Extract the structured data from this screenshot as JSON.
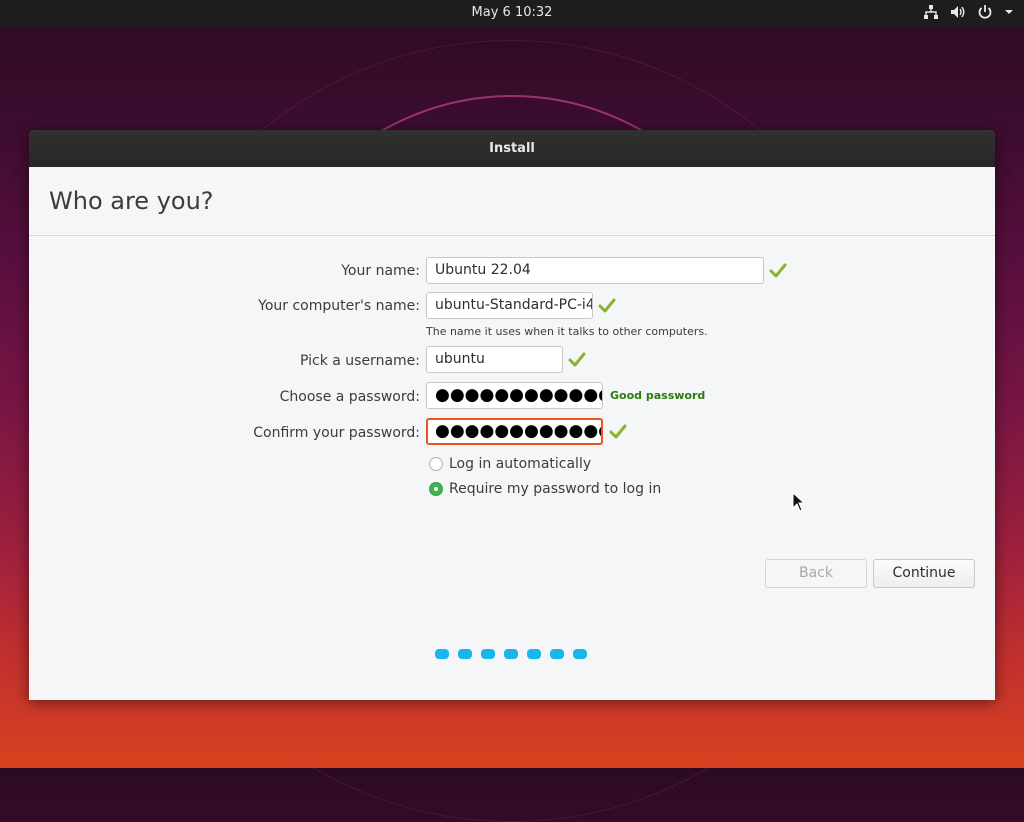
{
  "topbar": {
    "clock": "May 6  10:32",
    "icons": [
      "network-icon",
      "volume-icon",
      "power-icon",
      "menu-arrow-icon"
    ]
  },
  "window": {
    "title": "Install",
    "page_title": "Who are you?"
  },
  "form": {
    "name_label": "Your name:",
    "name_value": "Ubuntu 22.04",
    "computer_label": "Your computer's name:",
    "computer_value": "ubuntu-Standard-PC-i4",
    "computer_hint": "The name it uses when it talks to other computers.",
    "username_label": "Pick a username:",
    "username_value": "ubuntu",
    "password_label": "Choose a password:",
    "password_value": "●●●●●●●●●●●●",
    "password_strength": "Good password",
    "confirm_label": "Confirm your password:",
    "confirm_value": "●●●●●●●●●●●●",
    "login_auto_label": "Log in automatically",
    "login_require_label": "Require my password to log in",
    "selected_login_option": "Require my password to log in"
  },
  "buttons": {
    "back": "Back",
    "continue": "Continue"
  },
  "progress": {
    "steps_total": 7,
    "current_step": 7
  },
  "colors": {
    "accent": "#e95420",
    "check": "#8ab32f",
    "strength_good": "#2b7a0b",
    "progress_dot": "#19b6ee",
    "radio_selected": "#3eb34f"
  }
}
